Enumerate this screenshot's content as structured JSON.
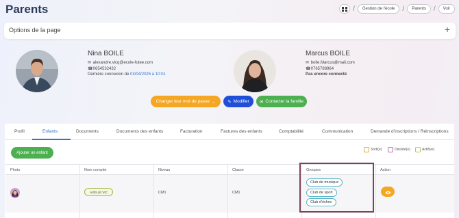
{
  "page": {
    "title": "Parents"
  },
  "breadcrumb": {
    "items": [
      "Gestion de l'école",
      "Parents",
      "Voir"
    ]
  },
  "options": {
    "label": "Options de la page",
    "expand": "+"
  },
  "parent1": {
    "name": "Nina BOILE",
    "email": "alexandre.vicq@ecole-futee.com",
    "phone": "0654532432",
    "last_login_label": "Dernière connexion de",
    "last_login_value": "03/04/2025 à 10:01"
  },
  "parent2": {
    "name": "Marcus BOILE",
    "email": "boile.Marcus@mail.com",
    "phone": "0765788964",
    "status": "Pas encore connecté"
  },
  "actions": {
    "change_password": "Changer leur mot de passe",
    "edit": "Modifier",
    "contact": "Contacter la famille"
  },
  "tabs": [
    "Profil",
    "Enfants",
    "Documents",
    "Documents des enfants",
    "Facturation",
    "Factures des enfants",
    "Comptabilité",
    "Communication",
    "Demande d'inscriptions / Réinscriptions"
  ],
  "active_tab": "Enfants",
  "children": {
    "add_label": "Ajouter un enfant",
    "legend": [
      {
        "label": "Sorti(e)",
        "color": "#e0a93a"
      },
      {
        "label": "Désisté(e)",
        "color": "#b56ab5"
      },
      {
        "label": "Actif(ve)",
        "color": "#b7c95a"
      }
    ],
    "columns": [
      "Photo",
      "Nom complet",
      "Niveau",
      "Classe",
      "Groupes",
      "Action"
    ],
    "rows": [
      {
        "name": "AXELLE VIC",
        "level": "CM1",
        "class": "CM1",
        "groups": [
          "Club de musique",
          "Club de sport",
          "Club d'échec"
        ]
      }
    ]
  },
  "colors": {
    "accent": "#2f72c6",
    "green": "#4caf50",
    "orange": "#f5a623",
    "blue": "#1f4ed8",
    "highlight": "#7b4154"
  }
}
